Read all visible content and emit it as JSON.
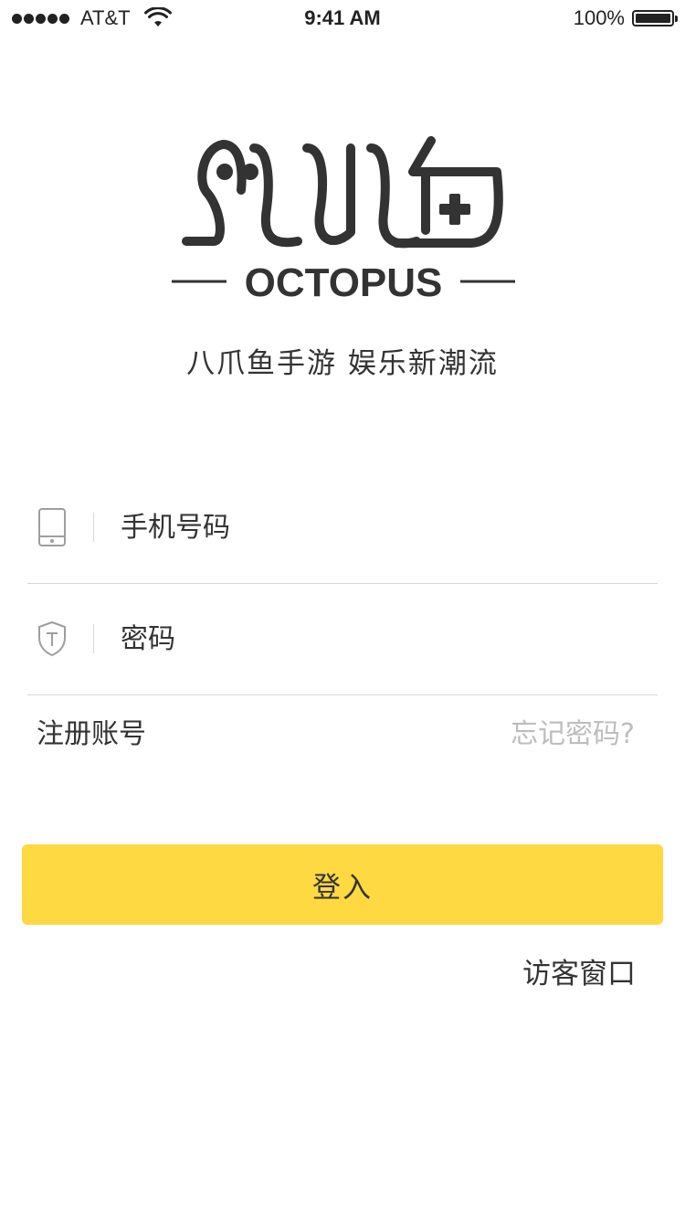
{
  "status_bar": {
    "carrier": "AT&T",
    "time": "9:41 AM",
    "battery": "100%",
    "signal_bars": 5
  },
  "logo": {
    "wordmark": "OCTOPUS",
    "icon": "octopus-logo-icon"
  },
  "tagline": "八爪鱼手游 娱乐新潮流",
  "form": {
    "phone": {
      "placeholder": "手机号码",
      "value": "",
      "icon": "phone-icon"
    },
    "password": {
      "placeholder": "密码",
      "value": "",
      "icon": "shield-icon"
    }
  },
  "links": {
    "register": "注册账号",
    "forgot": "忘记密码?",
    "guest": "访客窗口"
  },
  "buttons": {
    "login": "登入"
  },
  "colors": {
    "accent": "#fed942",
    "text": "#333333",
    "muted": "#bdbdbd",
    "divider": "#d8d8d8"
  }
}
